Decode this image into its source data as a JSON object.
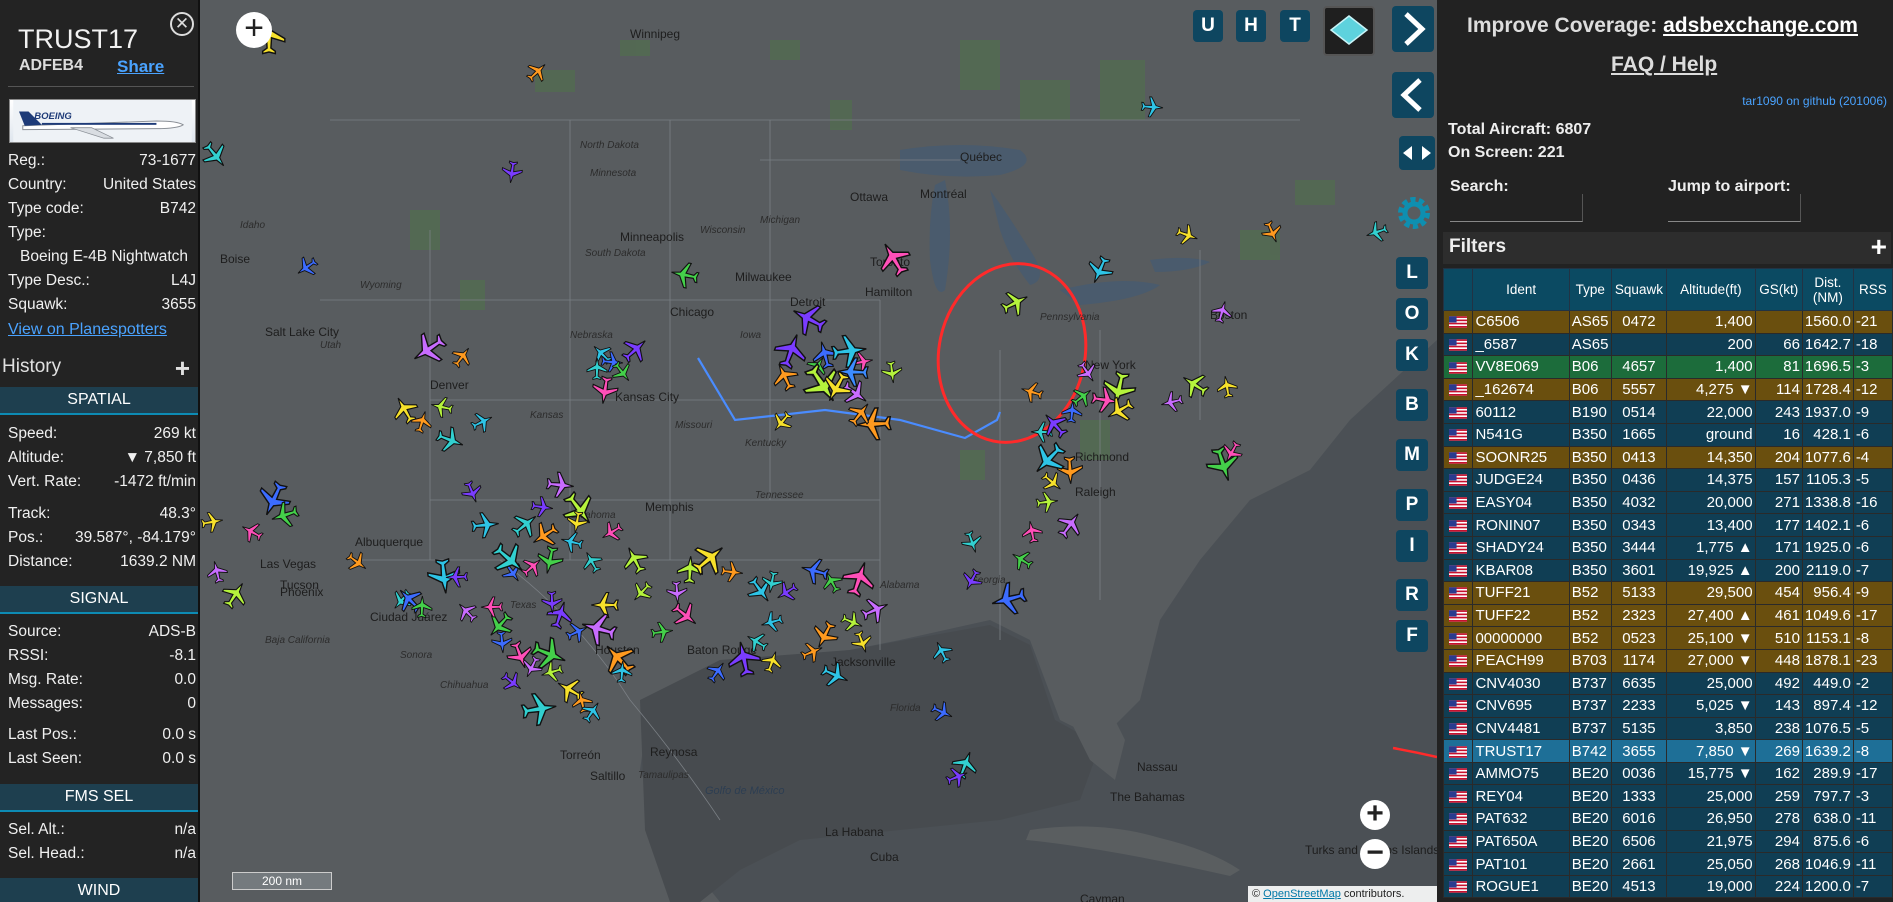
{
  "info": {
    "callsign": "TRUST17",
    "hex": "ADFEB4",
    "share": "Share",
    "photo_text": "BOEING",
    "fields": [
      {
        "k": "Reg.:",
        "v": "73-1677"
      },
      {
        "k": "Country:",
        "v": "United States"
      },
      {
        "k": "Type code:",
        "v": "B742"
      },
      {
        "k": "Type:",
        "v": ""
      },
      {
        "k": "",
        "v": "Boeing E-4B Nightwatch"
      },
      {
        "k": "Type Desc.:",
        "v": "L4J"
      },
      {
        "k": "Squawk:",
        "v": "3655"
      }
    ],
    "planespotters": "View on Planespotters",
    "history": "History",
    "spatial_hdr": "SPATIAL",
    "spatial": [
      {
        "k": "Speed:",
        "v": "269 kt"
      },
      {
        "k": "Altitude:",
        "v": "▼ 7,850 ft"
      },
      {
        "k": "Vert. Rate:",
        "v": "-1472 ft/min"
      },
      {
        "k": "Track:",
        "v": "48.3°"
      },
      {
        "k": "Pos.:",
        "v": "39.587°, -84.179°"
      },
      {
        "k": "Distance:",
        "v": "1639.2 NM"
      }
    ],
    "signal_hdr": "SIGNAL",
    "signal": [
      {
        "k": "Source:",
        "v": "ADS-B"
      },
      {
        "k": "RSSI:",
        "v": "-8.1"
      },
      {
        "k": "Msg. Rate:",
        "v": "0.0"
      },
      {
        "k": "Messages:",
        "v": "0"
      },
      {
        "k": "Last Pos.:",
        "v": "0.0 s"
      },
      {
        "k": "Last Seen:",
        "v": "0.0 s"
      }
    ],
    "fms_hdr": "FMS SEL",
    "fms": [
      {
        "k": "Sel. Alt.:",
        "v": "n/a"
      },
      {
        "k": "Sel. Head.:",
        "v": "n/a"
      }
    ],
    "wind_hdr": "WIND"
  },
  "map": {
    "buttons_top": [
      "U",
      "H",
      "T"
    ],
    "buttons_side": [
      "L",
      "O",
      "K",
      "B",
      "M",
      "P",
      "I",
      "R",
      "F"
    ],
    "scale": "200 nm",
    "attribution_prefix": "© ",
    "attribution_link": "OpenStreetMap",
    "attribution_suffix": " contributors.",
    "labels": [
      {
        "t": "Winnipeg"
      },
      {
        "t": "North Dakota"
      },
      {
        "t": "Minnesota"
      },
      {
        "t": "Minneapolis"
      },
      {
        "t": "South Dakota"
      },
      {
        "t": "Wisconsin"
      },
      {
        "t": "Michigan"
      },
      {
        "t": "Milwaukee"
      },
      {
        "t": "Detroit"
      },
      {
        "t": "Toronto"
      },
      {
        "t": "Ottawa"
      },
      {
        "t": "Montréal"
      },
      {
        "t": "Québec"
      },
      {
        "t": "Chicago"
      },
      {
        "t": "Hamilton"
      },
      {
        "t": "Boise"
      },
      {
        "t": "Wyoming"
      },
      {
        "t": "Idaho"
      },
      {
        "t": "Salt Lake City"
      },
      {
        "t": "Utah"
      },
      {
        "t": "Nebraska"
      },
      {
        "t": "Iowa"
      },
      {
        "t": "Kansas City"
      },
      {
        "t": "Kansas"
      },
      {
        "t": "Missouri"
      },
      {
        "t": "Kentucky"
      },
      {
        "t": "New York"
      },
      {
        "t": "Pennsylvania"
      },
      {
        "t": "Boston"
      },
      {
        "t": "Richmond"
      },
      {
        "t": "Raleigh"
      },
      {
        "t": "Tennessee"
      },
      {
        "t": "Memphis"
      },
      {
        "t": "Oklahoma"
      },
      {
        "t": "Albuquerque"
      },
      {
        "t": "Las Vegas"
      },
      {
        "t": "Phoenix"
      },
      {
        "t": "Tucson"
      },
      {
        "t": "Ciudad Juárez"
      },
      {
        "t": "Texas"
      },
      {
        "t": "Houston"
      },
      {
        "t": "Baton Rouge"
      },
      {
        "t": "Jacksonville"
      },
      {
        "t": "Alabama"
      },
      {
        "t": "Georgia"
      },
      {
        "t": "Florida"
      },
      {
        "t": "Chihuahua"
      },
      {
        "t": "Saltillo"
      },
      {
        "t": "Reynosa"
      },
      {
        "t": "Torreón"
      },
      {
        "t": "Tamaulipas"
      },
      {
        "t": "Golfo de México"
      },
      {
        "t": "La Habana"
      },
      {
        "t": "Cuba"
      },
      {
        "t": "Nassau"
      },
      {
        "t": "The Bahamas"
      },
      {
        "t": "Turks and Caicos Islands"
      },
      {
        "t": "Cayman"
      },
      {
        "t": "Baja California"
      },
      {
        "t": "Sonora"
      },
      {
        "t": "Denver"
      }
    ]
  },
  "sidebar": {
    "improve_prefix": "Improve Coverage: ",
    "improve_link": "adsbexchange.com",
    "faq": "FAQ / Help",
    "tar": "tar1090 on github (201006)",
    "total_label": "Total Aircraft: 6807",
    "onscreen_label": "On Screen: 221",
    "search_label": "Search:",
    "jump_label": "Jump to airport:",
    "filters": "Filters",
    "columns": [
      "",
      "Ident",
      "Type",
      "Squawk",
      "Altitude(ft)",
      "GS(kt)",
      "Dist.\n(NM)",
      "RSS"
    ],
    "rows": [
      {
        "ident": "C6506",
        "type": "AS65",
        "sq": "0472",
        "alt": "1,400",
        "gs": "",
        "dist": "1560.0",
        "rssi": "-21",
        "cls": "row-gold"
      },
      {
        "ident": "_6587",
        "type": "AS65",
        "sq": "",
        "alt": "200",
        "gs": "66",
        "dist": "1642.7",
        "rssi": "-18",
        "cls": "row-blue"
      },
      {
        "ident": "VV8E069",
        "type": "B06",
        "sq": "4657",
        "alt": "1,400",
        "gs": "81",
        "dist": "1696.5",
        "rssi": "-3",
        "cls": "row-green"
      },
      {
        "ident": "_162674",
        "type": "B06",
        "sq": "5557",
        "alt": "4,275 ▼",
        "gs": "114",
        "dist": "1728.4",
        "rssi": "-12",
        "cls": "row-gold"
      },
      {
        "ident": "60112",
        "type": "B190",
        "sq": "0514",
        "alt": "22,000",
        "gs": "243",
        "dist": "1937.0",
        "rssi": "-9",
        "cls": "row-blue"
      },
      {
        "ident": "N541G",
        "type": "B350",
        "sq": "1665",
        "alt": "ground",
        "gs": "16",
        "dist": "428.1",
        "rssi": "-6",
        "cls": "row-blue"
      },
      {
        "ident": "SOONR25",
        "type": "B350",
        "sq": "0413",
        "alt": "14,350",
        "gs": "204",
        "dist": "1077.6",
        "rssi": "-4",
        "cls": "row-gold"
      },
      {
        "ident": "JUDGE24",
        "type": "B350",
        "sq": "0436",
        "alt": "14,375",
        "gs": "157",
        "dist": "1105.3",
        "rssi": "-5",
        "cls": "row-blue"
      },
      {
        "ident": "EASY04",
        "type": "B350",
        "sq": "4032",
        "alt": "20,000",
        "gs": "271",
        "dist": "1338.8",
        "rssi": "-16",
        "cls": "row-blue"
      },
      {
        "ident": "RONIN07",
        "type": "B350",
        "sq": "0343",
        "alt": "13,400",
        "gs": "177",
        "dist": "1402.1",
        "rssi": "-6",
        "cls": "row-blue"
      },
      {
        "ident": "SHADY24",
        "type": "B350",
        "sq": "3444",
        "alt": "1,775 ▲",
        "gs": "171",
        "dist": "1925.0",
        "rssi": "-6",
        "cls": "row-blue"
      },
      {
        "ident": "KBAR08",
        "type": "B350",
        "sq": "3601",
        "alt": "19,925 ▲",
        "gs": "200",
        "dist": "2119.0",
        "rssi": "-7",
        "cls": "row-blue"
      },
      {
        "ident": "TUFF21",
        "type": "B52",
        "sq": "5133",
        "alt": "29,500",
        "gs": "454",
        "dist": "956.4",
        "rssi": "-9",
        "cls": "row-gold"
      },
      {
        "ident": "TUFF22",
        "type": "B52",
        "sq": "2323",
        "alt": "27,400 ▲",
        "gs": "461",
        "dist": "1049.6",
        "rssi": "-17",
        "cls": "row-gold"
      },
      {
        "ident": "00000000",
        "type": "B52",
        "sq": "0523",
        "alt": "25,100 ▼",
        "gs": "510",
        "dist": "1153.1",
        "rssi": "-8",
        "cls": "row-gold"
      },
      {
        "ident": "PEACH99",
        "type": "B703",
        "sq": "1174",
        "alt": "27,000 ▼",
        "gs": "448",
        "dist": "1878.1",
        "rssi": "-23",
        "cls": "row-gold"
      },
      {
        "ident": "CNV4030",
        "type": "B737",
        "sq": "6635",
        "alt": "25,000",
        "gs": "492",
        "dist": "449.0",
        "rssi": "-2",
        "cls": "row-blue"
      },
      {
        "ident": "CNV695",
        "type": "B737",
        "sq": "2233",
        "alt": "5,025 ▼",
        "gs": "143",
        "dist": "897.4",
        "rssi": "-12",
        "cls": "row-blue"
      },
      {
        "ident": "CNV4481",
        "type": "B737",
        "sq": "5135",
        "alt": "3,850",
        "gs": "238",
        "dist": "1076.5",
        "rssi": "-5",
        "cls": "row-blue"
      },
      {
        "ident": "TRUST17",
        "type": "B742",
        "sq": "3655",
        "alt": "7,850 ▼",
        "gs": "269",
        "dist": "1639.2",
        "rssi": "-8",
        "cls": "row-sel"
      },
      {
        "ident": "AMMO75",
        "type": "BE20",
        "sq": "0036",
        "alt": "15,775 ▼",
        "gs": "162",
        "dist": "289.9",
        "rssi": "-17",
        "cls": "row-blue"
      },
      {
        "ident": "REY04",
        "type": "BE20",
        "sq": "1333",
        "alt": "25,000",
        "gs": "259",
        "dist": "797.7",
        "rssi": "-3",
        "cls": "row-blue"
      },
      {
        "ident": "PAT632",
        "type": "BE20",
        "sq": "6016",
        "alt": "26,950",
        "gs": "278",
        "dist": "638.0",
        "rssi": "-11",
        "cls": "row-blue"
      },
      {
        "ident": "PAT650A",
        "type": "BE20",
        "sq": "6506",
        "alt": "21,975",
        "gs": "294",
        "dist": "875.6",
        "rssi": "-6",
        "cls": "row-blue"
      },
      {
        "ident": "PAT101",
        "type": "BE20",
        "sq": "2661",
        "alt": "25,050",
        "gs": "268",
        "dist": "1046.9",
        "rssi": "-11",
        "cls": "row-blue"
      },
      {
        "ident": "ROGUE1",
        "type": "BE20",
        "sq": "4513",
        "alt": "19,000",
        "gs": "224",
        "dist": "1200.0",
        "rssi": "-7",
        "cls": "row-blue"
      }
    ]
  },
  "colors": {
    "planes": [
      "#f7e12b",
      "#ff9a1f",
      "#2ec4e6",
      "#32d0d0",
      "#7a3cff",
      "#3c6cff",
      "#44d04a",
      "#ff4fb8",
      "#c86cff",
      "#b5f33c"
    ],
    "selected_highlight": "#ff2a2a",
    "track_line": "#4a8cff"
  }
}
